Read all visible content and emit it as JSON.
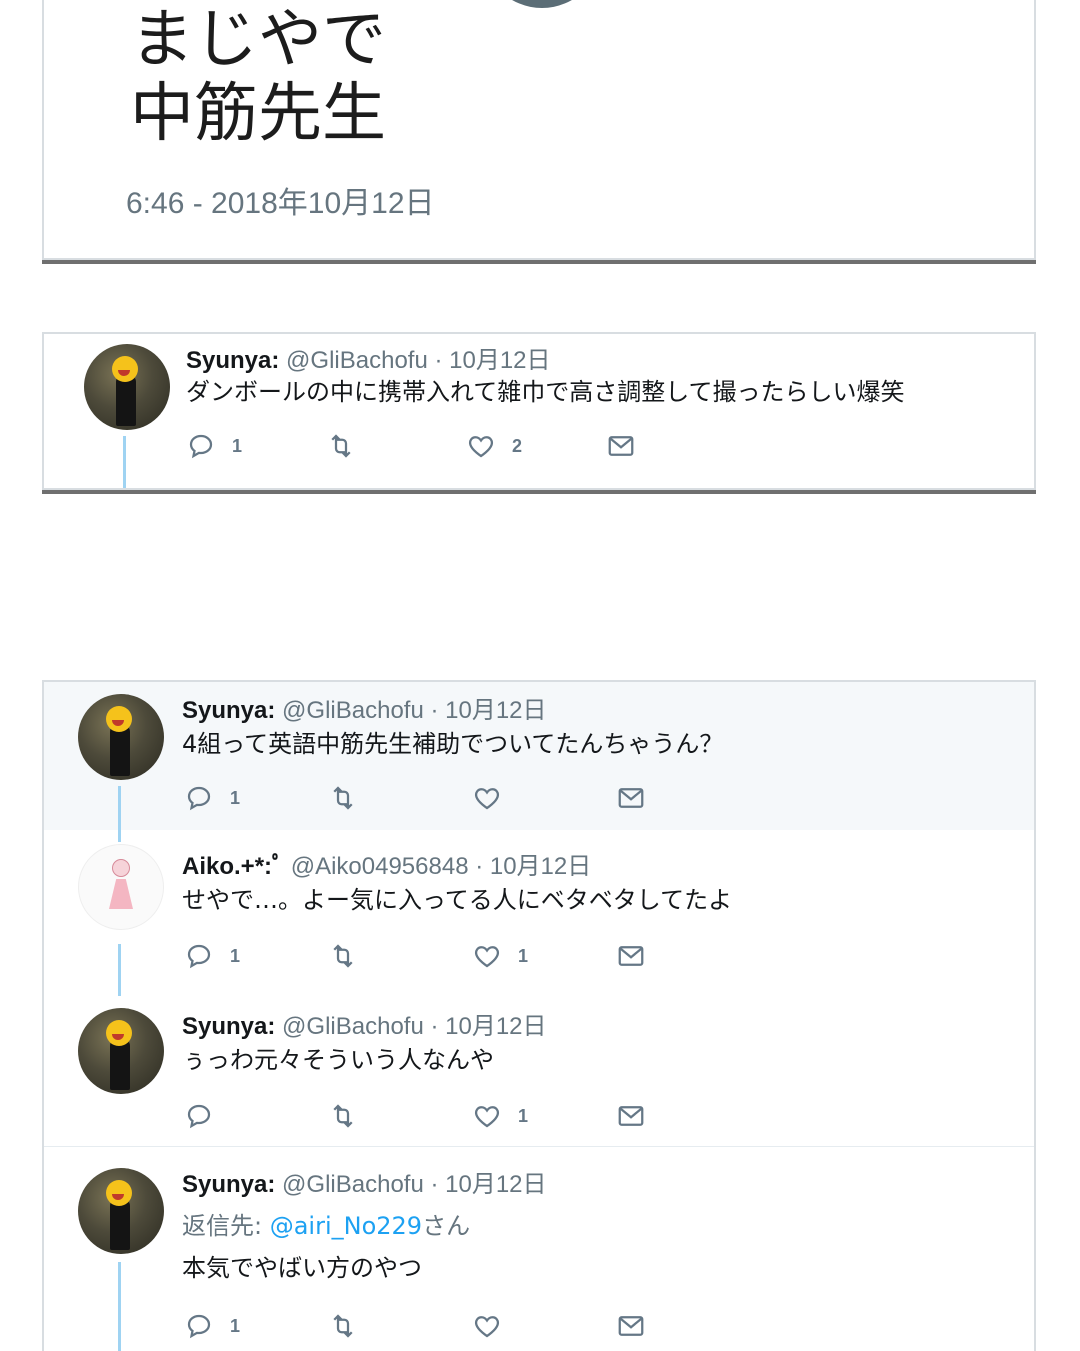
{
  "top_tweet": {
    "text_line1": "まじやで",
    "text_line2": "中筋先生",
    "timestamp": "6:46 - 2018年10月12日"
  },
  "tweet_a": {
    "name": "Syunya:",
    "handle": "@GliBachofu · 10月12日",
    "text": "ダンボールの中に携帯入れて雑巾で高さ調整して撮ったらしい爆笑",
    "reply_count": "1",
    "like_count": "2"
  },
  "thread": [
    {
      "name": "Syunya:",
      "handle": "@GliBachofu · 10月12日",
      "text": "4組って英語中筋先生補助でついてたんちゃうん？",
      "reply_count": "1",
      "like_count": ""
    },
    {
      "name": "Aiko.+*:ﾟ",
      "handle": "@Aiko04956848 · 10月12日",
      "text": "せやで…。よー気に入ってる人にベタベタしてたよ",
      "reply_count": "1",
      "like_count": "1"
    },
    {
      "name": "Syunya:",
      "handle": "@GliBachofu · 10月12日",
      "text": "ぅっわ元々そういう人なんや",
      "reply_count": "",
      "like_count": "1"
    },
    {
      "name": "Syunya:",
      "handle": "@GliBachofu · 10月12日",
      "reply_prefix": "返信先: ",
      "reply_link": "@airi_No229",
      "reply_suffix": "さん",
      "text": "本気でやばい方のやつ",
      "reply_count": "1",
      "like_count": ""
    }
  ],
  "colors": {
    "accent_link": "#1da1f2",
    "thread_line": "#9fd3f2",
    "muted": "#66757f",
    "highlight_bg": "#f5f8fa"
  },
  "icons": [
    "reply-icon",
    "retweet-icon",
    "like-icon",
    "message-icon"
  ]
}
